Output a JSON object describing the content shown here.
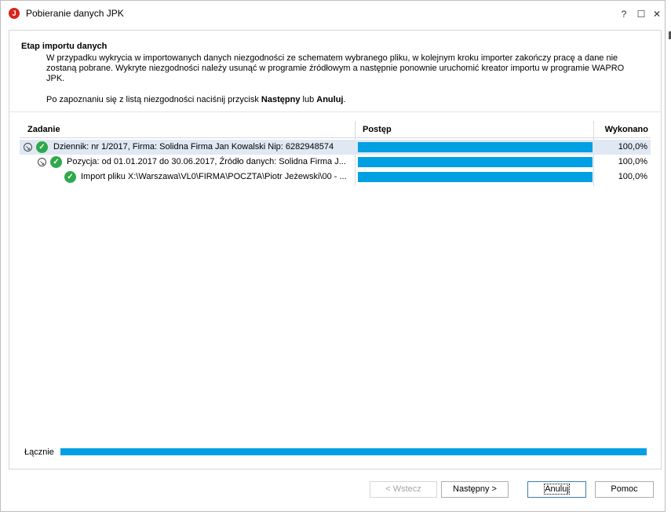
{
  "window": {
    "title": "Pobieranie danych JPK",
    "icon_letter": "J"
  },
  "header": {
    "title": "Etap importu danych",
    "description": "W przypadku wykrycia w importowanych danych niezgodności ze schematem wybranego pliku, w kolejnym kroku importer zakończy pracę a dane nie zostaną pobrane. Wykryte niezgodności należy usunąć w programie źródłowym a następnie ponownie uruchomić kreator importu w programie WAPRO JPK.",
    "note_prefix": "Po zapoznaniu się z listą niezgodności naciśnij przycisk ",
    "note_next": "Następny",
    "note_mid": " lub ",
    "note_cancel": "Anuluj",
    "note_suffix": "."
  },
  "grid": {
    "columns": {
      "task": "Zadanie",
      "progress": "Postęp",
      "done": "Wykonano"
    },
    "rows": [
      {
        "task": "Dziennik: nr 1/2017, Firma: Solidna Firma Jan Kowalski Nip: 6282948574",
        "percent": "100,0%",
        "progress": 1.0
      },
      {
        "task": "Pozycja: od 01.01.2017 do 30.06.2017, Źródło danych: Solidna Firma J...",
        "percent": "100,0%",
        "progress": 1.0
      },
      {
        "task": "Import pliku X:\\Warszawa\\VL0\\FIRMA\\POCZTA\\Piotr Jeżewski\\00 - ...",
        "percent": "100,0%",
        "progress": 1.0
      }
    ]
  },
  "total": {
    "label": "Łącznie",
    "progress": 1.0
  },
  "buttons": {
    "back": "< Wstecz",
    "next": "Następny >",
    "cancel": "Anuluj",
    "help": "Pomoc"
  },
  "colors": {
    "progress": "#00a0e3",
    "check": "#2ea84b",
    "selected_row": "#dfe8f3"
  }
}
